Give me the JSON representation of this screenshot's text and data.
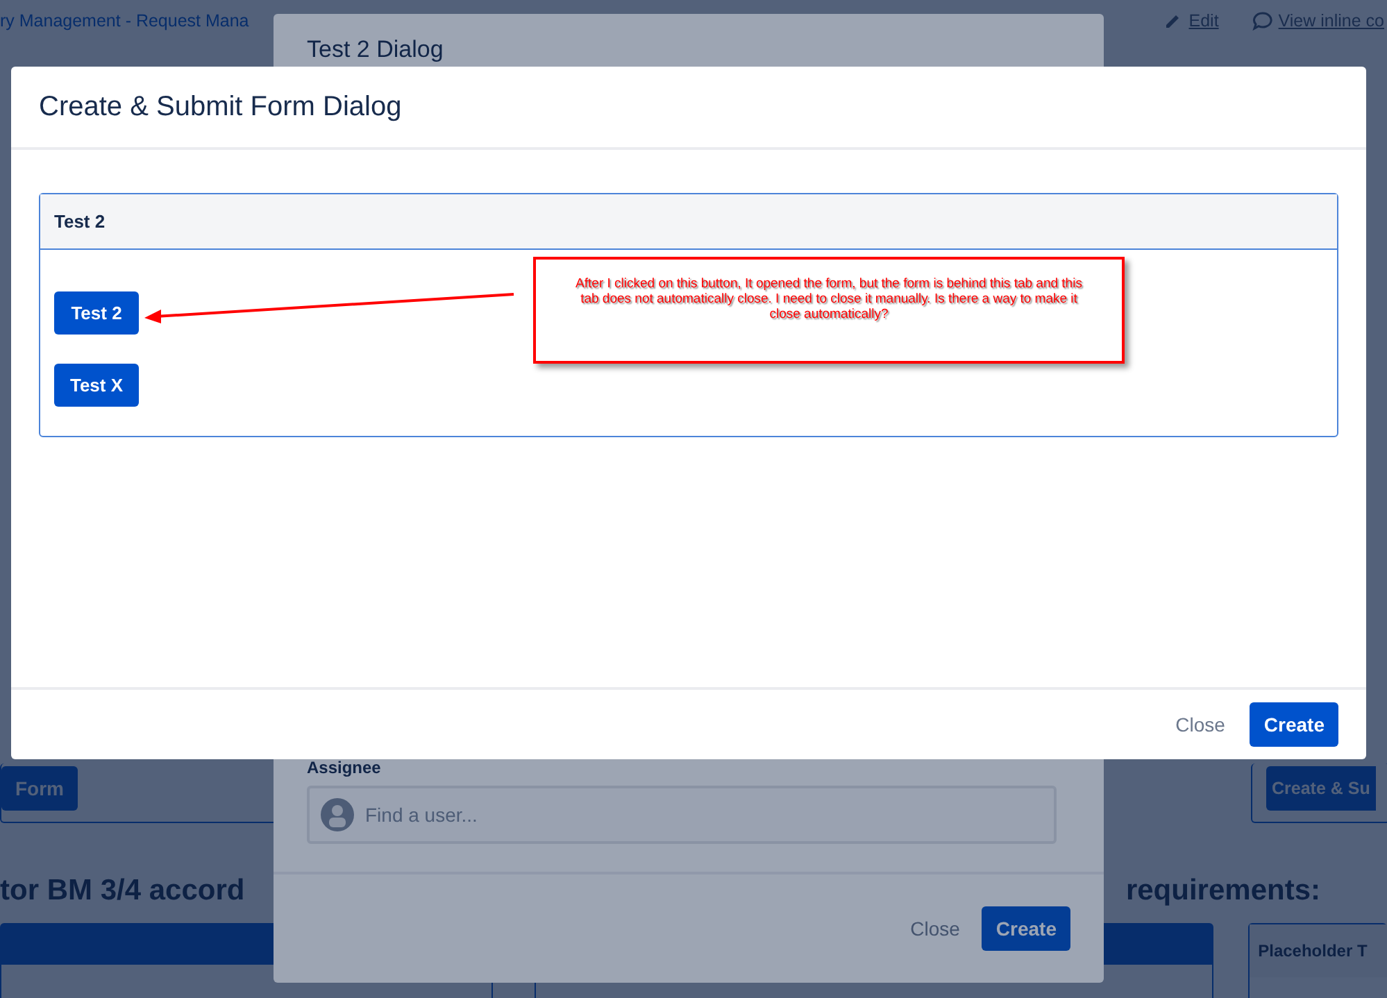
{
  "background_page": {
    "breadcrumb": "ry Management - Request Mana",
    "actions": [
      {
        "label": "Edit",
        "kind": "edit"
      },
      {
        "label": "View inline co",
        "kind": "comment"
      }
    ],
    "buttons": [
      "Form",
      "Create & Su"
    ],
    "headings": [
      "tor BM 3/4 accord",
      "requirements:"
    ],
    "card_header": "Placeholder T"
  },
  "background_dialog": {
    "title": "Test 2 Dialog",
    "field": {
      "label": "Assignee",
      "placeholder": "Find a user..."
    },
    "buttons": [
      {
        "label": "Close",
        "kind": "link"
      },
      {
        "label": "Create",
        "kind": "primary"
      }
    ]
  },
  "dialog": {
    "title": "Create & Submit Form Dialog",
    "panel": {
      "title": "Test 2",
      "buttons": [
        "Test 2",
        "Test X"
      ]
    },
    "annotation": "After I clicked on this button, It opened the form, but the form is behind this tab and this tab does not automatically close. I need to close it manually. Is there a way to make it close automatically?",
    "buttons": [
      {
        "label": "Close",
        "kind": "link"
      },
      {
        "label": "Create",
        "kind": "primary"
      }
    ]
  }
}
